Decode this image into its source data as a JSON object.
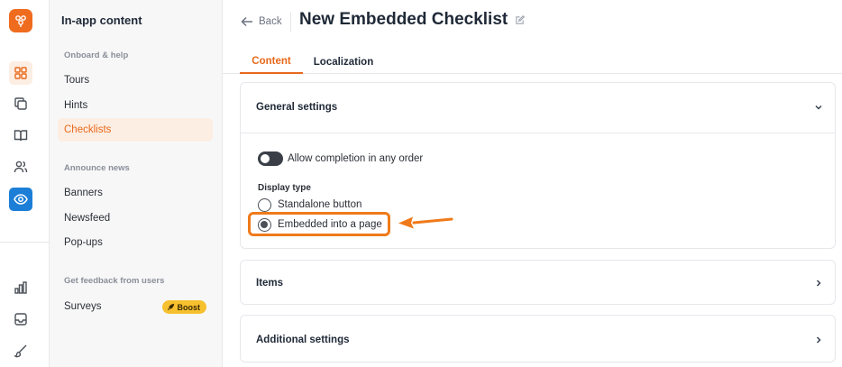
{
  "rail": {
    "icons": [
      "grid-icon",
      "copy-icon",
      "book-icon",
      "users-icon",
      "eye-icon",
      "bar-chart-icon",
      "inbox-icon",
      "brush-icon"
    ]
  },
  "sidebar": {
    "title": "In-app content",
    "sections": [
      {
        "label": "Onboard & help",
        "items": [
          "Tours",
          "Hints",
          "Checklists"
        ]
      },
      {
        "label": "Announce news",
        "items": [
          "Banners",
          "Newsfeed",
          "Pop-ups"
        ]
      },
      {
        "label": "Get feedback from users",
        "items": [
          "Surveys"
        ]
      }
    ],
    "active_item": "Checklists",
    "boost_label": "Boost"
  },
  "header": {
    "back_label": "Back",
    "title": "New Embedded Checklist"
  },
  "tabs": [
    {
      "label": "Content",
      "active": true
    },
    {
      "label": "Localization",
      "active": false
    }
  ],
  "general_settings": {
    "heading": "General settings",
    "toggle_label": "Allow completion in any order",
    "toggle_on": true,
    "display_type_label": "Display type",
    "options": [
      "Standalone button",
      "Embedded into a page"
    ],
    "selected_option": "Embedded into a page"
  },
  "items_card": {
    "heading": "Items"
  },
  "additional_card": {
    "heading": "Additional settings"
  },
  "colors": {
    "accent": "#e8691c",
    "accent_soft": "#fdeee3",
    "highlight": "#ef7a1a",
    "active_blue": "#1c7ed6",
    "boost": "#f6c02e"
  }
}
